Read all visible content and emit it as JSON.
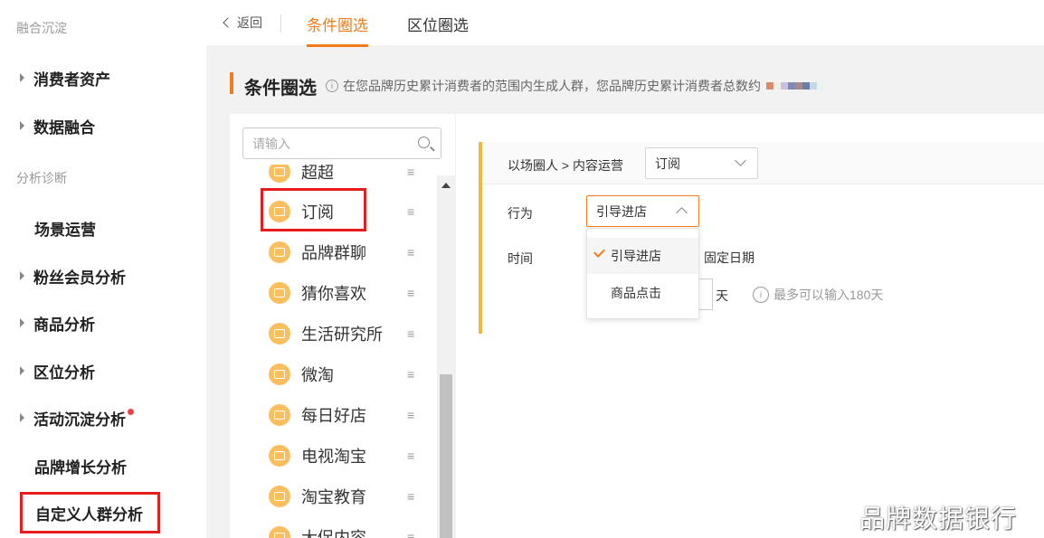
{
  "sidebar": {
    "sections": [
      "融合沉淀",
      "分析诊断"
    ],
    "items": [
      {
        "label": "消费者资产"
      },
      {
        "label": "数据融合"
      },
      {
        "label": "场景运营"
      },
      {
        "label": "粉丝会员分析"
      },
      {
        "label": "商品分析"
      },
      {
        "label": "区位分析"
      },
      {
        "label": "活动沉淀分析"
      },
      {
        "label": "品牌增长分析"
      },
      {
        "label": "自定义人群分析"
      }
    ]
  },
  "topbar": {
    "back_label": "返回",
    "tabs": [
      "条件圈选",
      "区位圈选"
    ]
  },
  "header": {
    "title": "条件圈选",
    "info": "在您品牌历史累计消费者的范围内生成人群，您品牌历史累计消费者总数约"
  },
  "category_panel": {
    "search_placeholder": "请输入",
    "items": [
      "超超",
      "订阅",
      "品牌群聊",
      "猜你喜欢",
      "生活研究所",
      "微淘",
      "每日好店",
      "电视淘宝",
      "淘宝教育",
      "大促内容"
    ]
  },
  "filter": {
    "breadcrumb": "以场圈人 > 内容运营",
    "category_select": "订阅",
    "behavior_label": "行为",
    "behavior_select": "引导进店",
    "time_label": "时间",
    "dropdown_options": [
      "引导进店",
      "商品点击"
    ],
    "fixed_date": "固定日期",
    "day_unit": "天",
    "hint": "最多可以输入180天"
  },
  "watermark": "品牌数据银行",
  "colors": {
    "accent": "#f07c1b",
    "highlight_box": "#e81c1c",
    "card_bar": "#f5b53f",
    "icon_bg": "#fbbf60"
  }
}
